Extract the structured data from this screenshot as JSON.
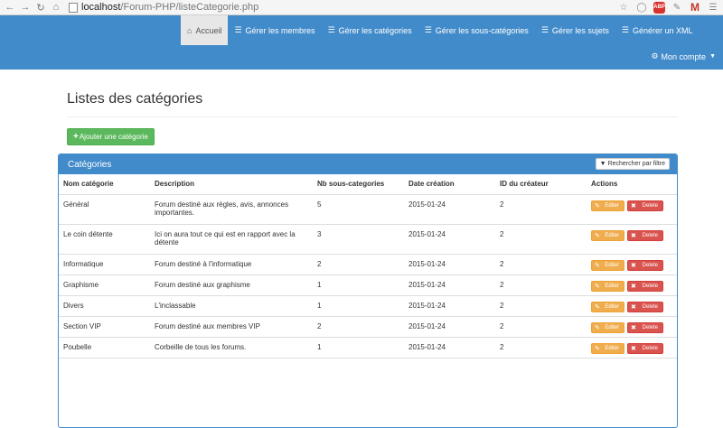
{
  "browser": {
    "url_host": "localhost",
    "url_path": "/Forum-PHP/listeCategorie.php"
  },
  "navbar": {
    "items": [
      {
        "label": "Accueil",
        "icon": "home-icon",
        "active": true
      },
      {
        "label": "Gérer les membres",
        "icon": "list-icon"
      },
      {
        "label": "Gérer les catégories",
        "icon": "list-icon"
      },
      {
        "label": "Gérer les sous-catégories",
        "icon": "list-icon"
      },
      {
        "label": "Gérer les sujets",
        "icon": "list-icon"
      },
      {
        "label": "Générer un XML",
        "icon": "list-icon"
      }
    ],
    "account_label": "Mon compte",
    "accent": "#428bca"
  },
  "page": {
    "title": "Listes des catégories",
    "add_button": "Ajouter une catégorie"
  },
  "panel": {
    "title": "Catégories",
    "filter_button": "Rechercher par filtre",
    "columns": [
      "Nom catégorie",
      "Description",
      "Nb sous-categories",
      "Date création",
      "ID du créateur",
      "Actions"
    ],
    "edit_label": "Editer",
    "delete_label": "Delete",
    "rows": [
      {
        "name": "Général",
        "desc": "Forum destiné aux règles, avis, annonces importantes.",
        "nb": "5",
        "date": "2015-01-24",
        "creator": "2"
      },
      {
        "name": "Le coin détente",
        "desc": "Ici on aura tout ce qui est en rapport avec la détente",
        "nb": "3",
        "date": "2015-01-24",
        "creator": "2"
      },
      {
        "name": "Informatique",
        "desc": "Forum destiné à l'informatique",
        "nb": "2",
        "date": "2015-01-24",
        "creator": "2"
      },
      {
        "name": "Graphisme",
        "desc": "Forum destiné aux graphisme",
        "nb": "1",
        "date": "2015-01-24",
        "creator": "2"
      },
      {
        "name": "Divers",
        "desc": "L'inclassable",
        "nb": "1",
        "date": "2015-01-24",
        "creator": "2"
      },
      {
        "name": "Section VIP",
        "desc": "Forum destiné aux membres VIP",
        "nb": "2",
        "date": "2015-01-24",
        "creator": "2"
      },
      {
        "name": "Poubelle",
        "desc": "Corbeille de tous les forums.",
        "nb": "1",
        "date": "2015-01-24",
        "creator": "2"
      }
    ]
  }
}
